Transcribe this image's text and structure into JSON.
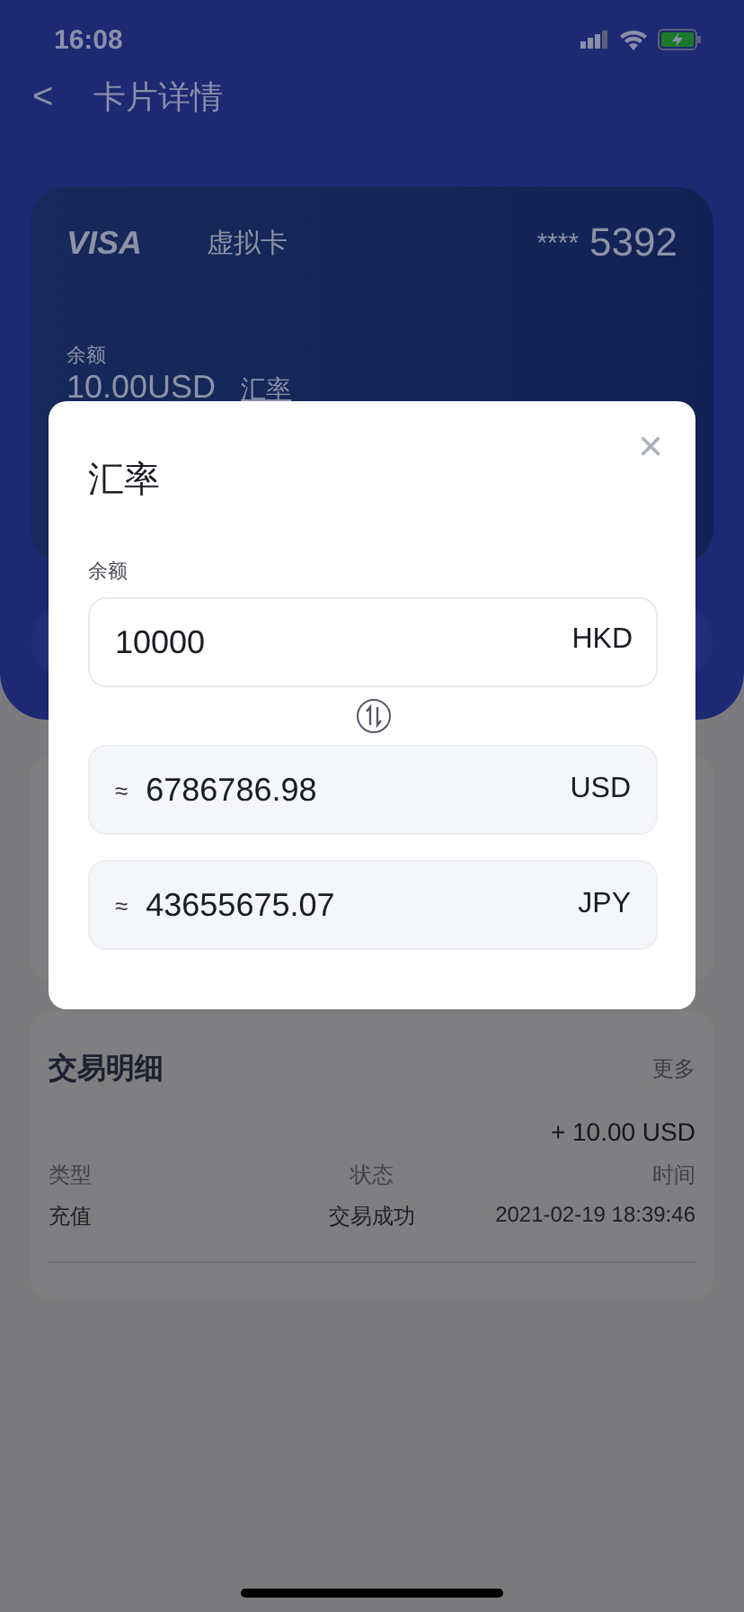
{
  "status_bar": {
    "time": "16:08"
  },
  "nav": {
    "back": "<",
    "title": "卡片详情"
  },
  "card": {
    "brand": "VISA",
    "type": "虚拟卡",
    "mask": "****",
    "last4": "5392",
    "balance_label": "余额",
    "balance": "10.00USD",
    "rate_link": "汇率"
  },
  "transactions": {
    "title": "交易明细",
    "more": "更多",
    "amount": "+ 10.00 USD",
    "columns": [
      "类型",
      "状态",
      "时间"
    ],
    "values": [
      "充值",
      "交易成功",
      "2021-02-19 18:39:46"
    ]
  },
  "dialog": {
    "title": "汇率",
    "close": "×",
    "amount_label": "余额",
    "input": {
      "value": "10000",
      "currency": "HKD"
    },
    "results": [
      {
        "approx": "≈",
        "value": "6786786.98",
        "currency": "USD"
      },
      {
        "approx": "≈",
        "value": "43655675.07",
        "currency": "JPY"
      }
    ]
  }
}
